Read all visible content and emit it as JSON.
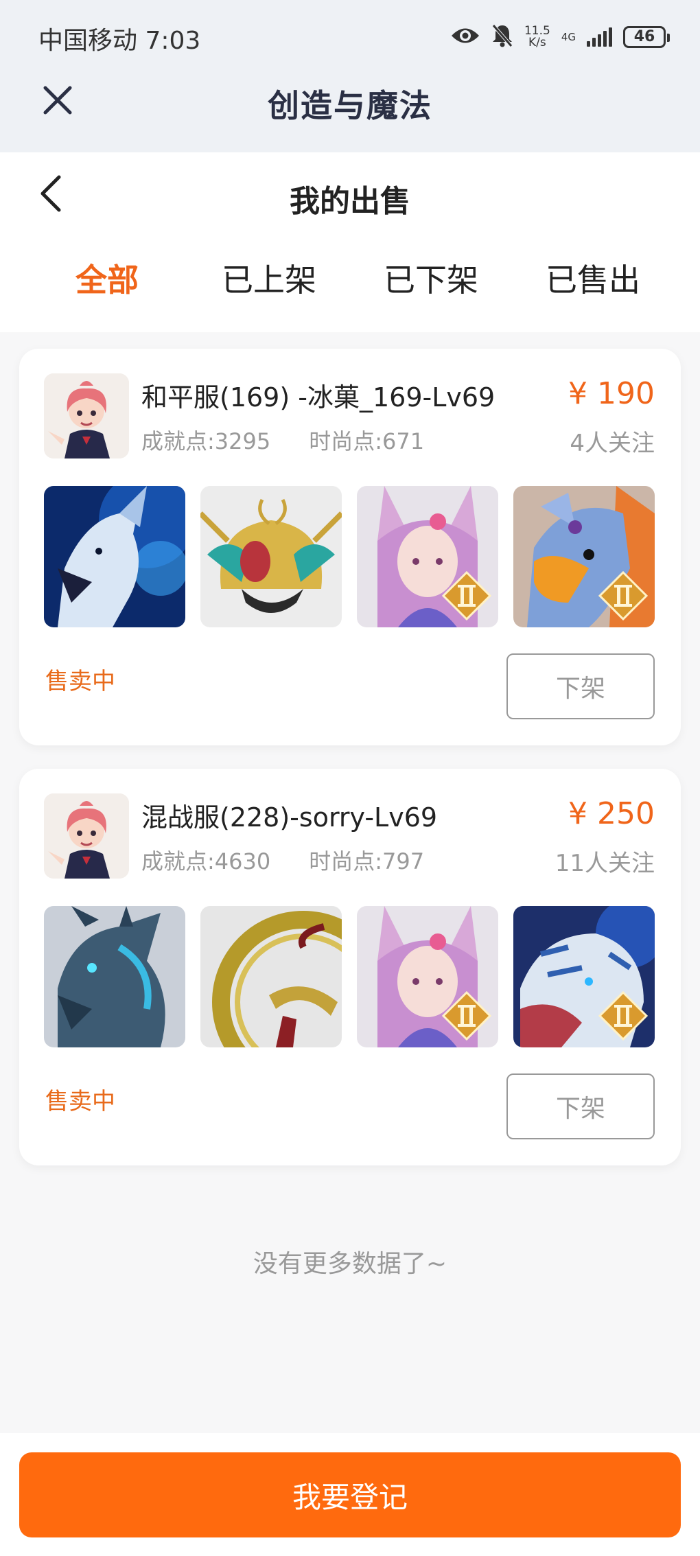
{
  "status_bar": {
    "carrier_time": "中国移动 7:03",
    "speed_value": "11.5",
    "speed_unit": "K/s",
    "network": "4G",
    "battery": "46"
  },
  "app": {
    "title": "创造与魔法"
  },
  "page": {
    "title": "我的出售"
  },
  "tabs": [
    {
      "label": "全部",
      "active": true
    },
    {
      "label": "已上架",
      "active": false
    },
    {
      "label": "已下架",
      "active": false
    },
    {
      "label": "已售出",
      "active": false
    }
  ],
  "listings": [
    {
      "server": "和平服(169) -冰菓_169-Lv69",
      "achievement": "成就点:3295",
      "fashion": "时尚点:671",
      "price": "¥ 190",
      "followers": "4人关注",
      "status": "售卖中",
      "action": "下架",
      "items": [
        "blue-wolf-mount",
        "golden-helmet",
        "fox-girl",
        "griffin-mount"
      ]
    },
    {
      "server": "混战服(228)-sorry-Lv69",
      "achievement": "成就点:4630",
      "fashion": "时尚点:797",
      "price": "¥ 250",
      "followers": "11人关注",
      "status": "售卖中",
      "action": "下架",
      "items": [
        "dragon-horse-mount",
        "golden-ring",
        "fox-girl",
        "ice-tiger-mount"
      ]
    }
  ],
  "footer": {
    "no_more": "没有更多数据了~",
    "register_label": "我要登记"
  },
  "colors": {
    "accent": "#f0651a",
    "primary_button": "#ff6a0e",
    "muted_text": "#999999"
  }
}
